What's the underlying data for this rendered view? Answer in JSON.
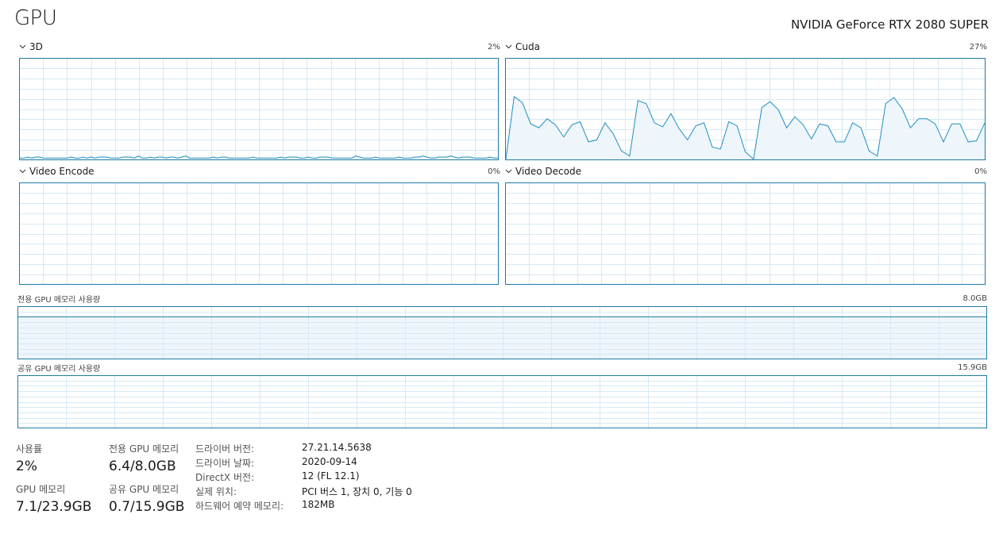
{
  "header": {
    "title": "GPU",
    "device_name": "NVIDIA GeForce RTX 2080 SUPER"
  },
  "engines": {
    "3d": {
      "label": "3D",
      "value": "2%"
    },
    "cuda": {
      "label": "Cuda",
      "value": "27%"
    },
    "video_encode": {
      "label": "Video Encode",
      "value": "0%"
    },
    "video_decode": {
      "label": "Video Decode",
      "value": "0%"
    }
  },
  "memory_graphs": {
    "dedicated": {
      "label": "전용 GPU 메모리 사용량",
      "max": "8.0GB"
    },
    "shared": {
      "label": "공유 GPU 메모리 사용량",
      "max": "15.9GB"
    }
  },
  "stats": {
    "utilization": {
      "label": "사용률",
      "value": "2%"
    },
    "dedicated_memory": {
      "label": "전용 GPU 메모리",
      "value": "6.4/8.0GB"
    },
    "gpu_memory": {
      "label": "GPU 메모리",
      "value": "7.1/23.9GB"
    },
    "shared_memory": {
      "label": "공유 GPU 메모리",
      "value": "0.7/15.9GB"
    }
  },
  "properties": [
    {
      "label": "드라이버 버전:",
      "value": "27.21.14.5638"
    },
    {
      "label": "드라이버 날짜:",
      "value": "2020-09-14"
    },
    {
      "label": "DirectX 버전:",
      "value": "12 (FL 12.1)"
    },
    {
      "label": "실제 위치:",
      "value": "PCI 버스 1, 장치 0, 기능 0"
    },
    {
      "label": "하드웨어 예약 메모리:",
      "value": "182MB"
    }
  ],
  "colors": {
    "line": "#1f8fbf",
    "fill": "#eef5fb",
    "grid": "#d6e9f5",
    "border": "#1f7aa3"
  },
  "icons": {
    "collapse": "chevron-down-icon"
  },
  "series": {
    "3d": [
      1,
      1,
      2,
      1,
      2,
      2,
      1,
      1,
      1,
      1,
      1,
      1,
      1,
      2,
      1,
      1,
      2,
      1,
      2,
      1,
      2,
      2,
      2,
      1,
      1,
      1,
      2,
      2,
      2,
      1,
      3,
      1,
      1,
      2,
      1,
      2,
      2,
      1,
      2,
      2,
      1,
      2,
      3,
      1,
      1,
      1,
      1,
      1,
      1,
      2,
      1,
      2,
      2,
      1,
      1,
      1,
      1,
      1,
      1,
      2,
      1,
      1,
      1,
      1,
      1,
      1,
      2,
      1,
      2,
      2,
      2,
      1,
      1,
      2,
      1,
      1,
      2,
      2,
      2,
      1,
      1,
      1,
      1,
      1,
      1,
      3,
      2,
      1,
      1,
      1,
      2,
      1,
      1,
      1,
      1,
      1,
      2,
      1,
      1,
      1,
      2,
      2,
      3,
      2,
      1,
      1,
      2,
      2,
      2,
      3,
      2,
      1,
      2,
      2,
      2,
      1,
      1,
      1,
      1,
      2,
      1,
      1
    ],
    "cuda": [
      0,
      62,
      56,
      35,
      31,
      40,
      34,
      22,
      34,
      37,
      17,
      19,
      36,
      25,
      8,
      3,
      58,
      55,
      36,
      32,
      45,
      30,
      19,
      33,
      36,
      12,
      10,
      37,
      33,
      7,
      0,
      51,
      57,
      49,
      31,
      42,
      34,
      20,
      35,
      33,
      17,
      17,
      36,
      31,
      8,
      3,
      55,
      61,
      50,
      31,
      40,
      40,
      35,
      17,
      35,
      35,
      17,
      18,
      36
    ]
  }
}
